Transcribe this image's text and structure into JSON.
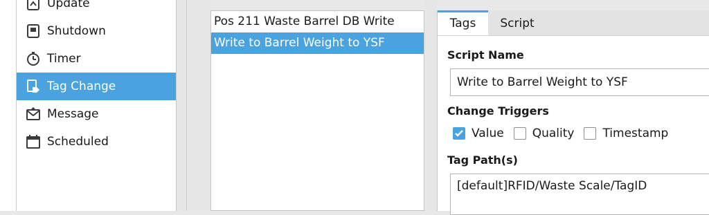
{
  "sidebar": {
    "items": [
      {
        "label": "Update",
        "icon": "update-icon"
      },
      {
        "label": "Shutdown",
        "icon": "shutdown-icon"
      },
      {
        "label": "Timer",
        "icon": "timer-icon"
      },
      {
        "label": "Tag Change",
        "icon": "tag-change-icon",
        "selected": true
      },
      {
        "label": "Message",
        "icon": "message-icon"
      },
      {
        "label": "Scheduled",
        "icon": "calendar-icon"
      }
    ]
  },
  "scripts": {
    "items": [
      {
        "label": "Pos 211 Waste Barrel DB Write"
      },
      {
        "label": "Write to Barrel Weight to YSF",
        "selected": true
      }
    ]
  },
  "editor": {
    "tabs": [
      {
        "label": "Tags",
        "active": true
      },
      {
        "label": "Script"
      }
    ],
    "script_name_label": "Script Name",
    "script_name_value": "Write to Barrel Weight to YSF",
    "change_triggers_label": "Change Triggers",
    "triggers": [
      {
        "label": "Value",
        "checked": true
      },
      {
        "label": "Quality",
        "checked": false
      },
      {
        "label": "Timestamp",
        "checked": false
      }
    ],
    "tag_paths_label": "Tag Path(s)",
    "tag_paths_value": "[default]RFID/Waste Scale/TagID"
  },
  "colors": {
    "accent": "#4aa3df"
  }
}
